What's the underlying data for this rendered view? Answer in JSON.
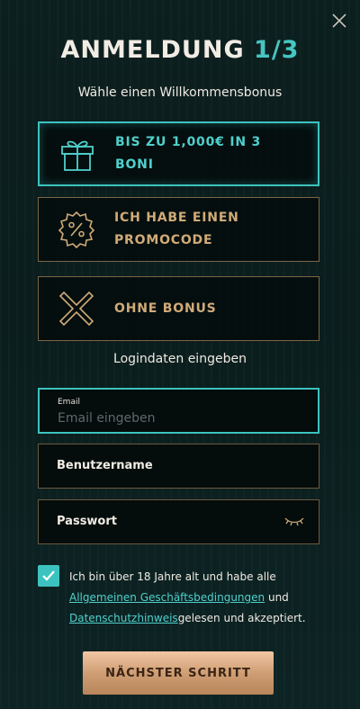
{
  "header": {
    "title_main": "ANMELDUNG ",
    "title_step": "1/3",
    "subtitle": "Wähle einen Willkommensbonus",
    "close_icon": "close-icon"
  },
  "bonus_options": [
    {
      "label": "BIS ZU 1,000€ IN 3 BONI",
      "icon": "gift-icon",
      "selected": true
    },
    {
      "label": "ICH HABE EINEN PROMOCODE",
      "icon": "promo-percent-icon",
      "selected": false
    },
    {
      "label": "OHNE BONUS",
      "icon": "no-bonus-x-icon",
      "selected": false
    }
  ],
  "login": {
    "section_label": "Logindaten eingeben",
    "email_label": "Email",
    "email_placeholder": "Email eingeben",
    "email_value": "",
    "username_placeholder": "Benutzername",
    "password_placeholder": "Passwort",
    "password_icon": "eye-closed-icon"
  },
  "terms": {
    "checked": true,
    "text_before": "Ich bin über 18 Jahre alt und habe alle ",
    "link_terms": "Allgemeinen Geschäftsbedingungen",
    "text_mid": " und ",
    "link_privacy": "Datenschutzhinweis",
    "text_after": "gelesen und akzeptiert."
  },
  "actions": {
    "next_label": "NÄCHSTER SCHRITT"
  },
  "colors": {
    "accent": "#3cc3bf",
    "gold": "#d0ab78",
    "button": "#cf9e74",
    "background": "#0c1f1f"
  }
}
